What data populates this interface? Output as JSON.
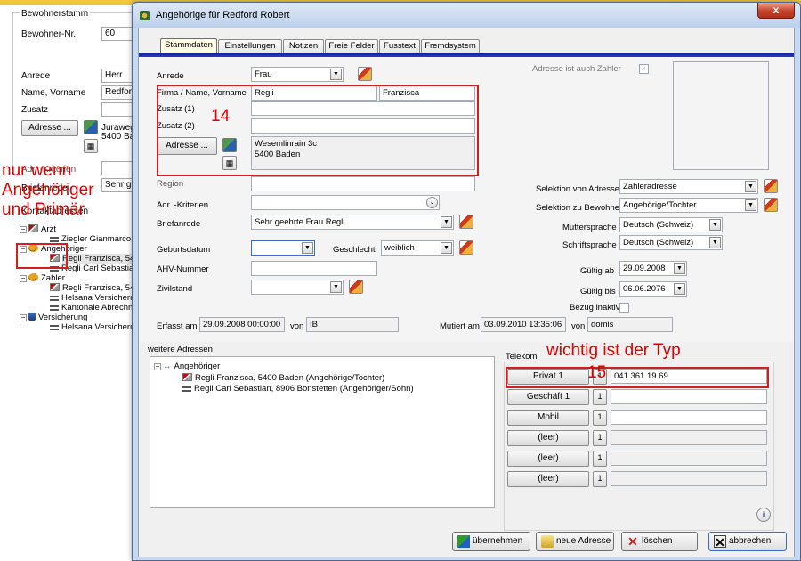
{
  "background_window": {
    "group_title": "Bewohnerstamm",
    "bewohner_nr_label": "Bewohner-Nr.",
    "bewohner_nr_value": "60",
    "anrede_label": "Anrede",
    "anrede_value": "Herr",
    "name_label": "Name, Vorname",
    "name_value": "Redford",
    "zusatz_label": "Zusatz",
    "adresse_button": "Adresse ...",
    "address_line1": "Juraweg",
    "address_line2": "5400 Ba",
    "kriterien_label": "Adr. -Kriterien",
    "briefanrede_label": "Briefanrede",
    "briefanrede_value": "Sehr gee",
    "kontakt_label": "Kontaktadressen",
    "tree": {
      "arzt": "Arzt",
      "arzt_child": "Ziegler Gianmarco, 5",
      "angehoeriger": "Angehöriger",
      "ang_child1": "Regli Franzisca, 540",
      "ang_child2": "Regli Carl Sebastian",
      "zahler": "Zahler",
      "zahler_child1": "Regli Franzisca, 540",
      "zahler_child2": "Helsana Versicherun",
      "zahler_child3": "Kantonale Abrechnu",
      "versicherung": "Versicherung",
      "vers_child1": "Helsana Versicherun"
    }
  },
  "annotations": {
    "note_left_line1": "nur wenn",
    "note_left_line2": "Angehöriger",
    "note_left_line3": "und Primär",
    "number_14": "14",
    "number_15": "15",
    "note_type": "wichtig ist der Typ"
  },
  "dialog": {
    "title": "Angehörige für Redford Robert",
    "close_label": "x",
    "tabs": [
      "Stammdaten",
      "Einstellungen",
      "Notizen",
      "Freie Felder",
      "Fusstext",
      "Fremdsystem"
    ],
    "form": {
      "anrede_label": "Anrede",
      "anrede_value": "Frau",
      "firma_label": "Firma / Name, Vorname",
      "name_value": "Regli",
      "vorname_value": "Franzisca",
      "zusatz1_label": "Zusatz (1)",
      "zusatz2_label": "Zusatz (2)",
      "adresse_button": "Adresse ...",
      "address_line1": "Wesemlinrain 3c",
      "address_line2": "5400 Baden",
      "region_label": "Region",
      "kriterien_label": "Adr. -Kriterien",
      "briefanrede_label": "Briefanrede",
      "briefanrede_value": "Sehr geehrte Frau Regli",
      "geburtsdatum_label": "Geburtsdatum",
      "geschlecht_label": "Geschlecht",
      "geschlecht_value": "weiblich",
      "ahv_label": "AHV-Nummer",
      "zivilstand_label": "Zivilstand",
      "zahler_label": "Adresse ist auch Zahler",
      "selektion_adresse_label": "Selektion von Adresse",
      "selektion_adresse_value": "Zahleradresse",
      "selektion_bewohner_label": "Selektion zu Bewohner",
      "selektion_bewohner_value": "Angehörige/Tochter",
      "muttersprache_label": "Muttersprache",
      "muttersprache_value": "Deutsch (Schweiz)",
      "schriftsprache_label": "Schriftsprache",
      "schriftsprache_value": "Deutsch (Schweiz)",
      "gueltig_ab_label": "Gültig ab",
      "gueltig_ab_value": "29.09.2008",
      "gueltig_bis_label": "Gültig bis",
      "gueltig_bis_value": "06.06.2076",
      "bezug_inaktiv_label": "Bezug inaktiv",
      "erfasst_label": "Erfasst am",
      "erfasst_value": "29.09.2008 00:00:00",
      "von_label": "von",
      "erfasst_von_value": "IB",
      "mutiert_label": "Mutiert am",
      "mutiert_value": "03.09.2010 13:35:06",
      "mutiert_von_value": "domis"
    },
    "weitere": {
      "title": "weitere Adressen",
      "root": "Angehöriger",
      "item1": "Regli Franzisca, 5400 Baden (Angehörige/Tochter)",
      "item2": "Regli Carl Sebastian, 8906 Bonstetten (Angehöriger/Sohn)"
    },
    "telekom": {
      "title": "Telekom",
      "rows": [
        {
          "type": "Privat 1",
          "value": "041 361 19 69"
        },
        {
          "type": "Geschäft 1",
          "value": ""
        },
        {
          "type": "Mobil",
          "value": ""
        },
        {
          "type": "(leer)",
          "value": ""
        },
        {
          "type": "(leer)",
          "value": ""
        },
        {
          "type": "(leer)",
          "value": ""
        }
      ],
      "action_symbol": "1",
      "info_symbol": "i"
    },
    "buttons": {
      "uebernehmen": "übernehmen",
      "neue_adresse": "neue Adresse",
      "loeschen": "löschen",
      "abbrechen": "abbrechen"
    }
  }
}
